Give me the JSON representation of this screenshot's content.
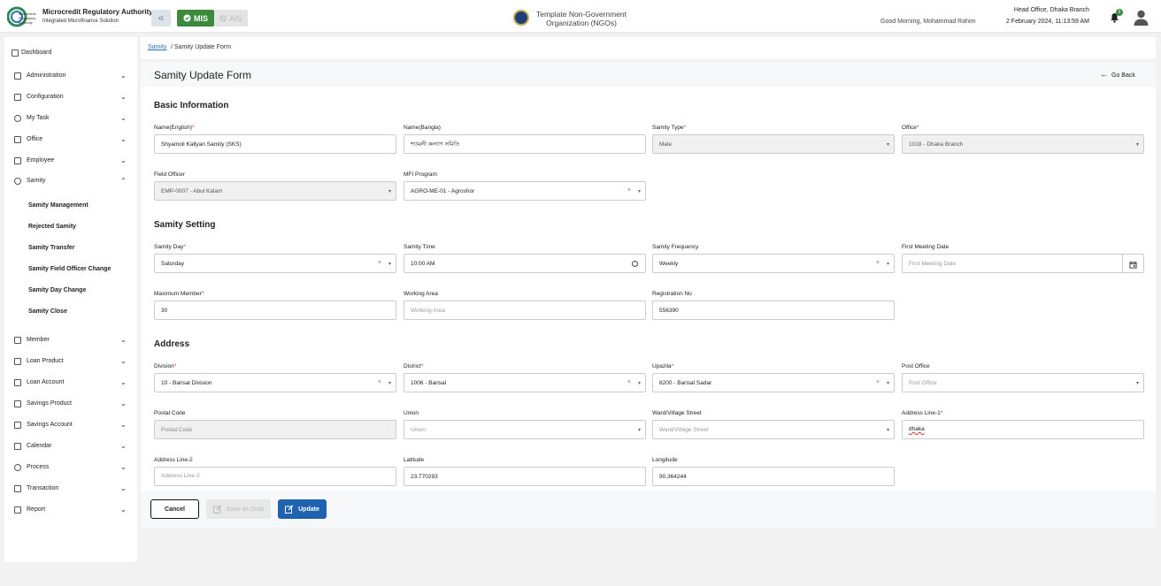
{
  "header": {
    "org_name": "Microcredit Regulatory Authority",
    "org_subtitle": "Integrated Microfinance Solution",
    "logo_text": "Microcredit Regulatory Authority",
    "mis_label": "MIS",
    "ais_label": "AIS",
    "ngo_title": "Template Non-Government Organization (NGOs)",
    "greeting": "Good Morning, Mohammad Rahim",
    "branch": "Head Office, Dhaka Branch",
    "datetime": "2 February 2024, 11:13:59 AM",
    "notification_count": "0",
    "accent_green": "#3b8a3e",
    "accent_blue": "#1f62b0"
  },
  "sidebar": {
    "dashboard": "Dashboard",
    "items": [
      {
        "label": "Administration",
        "icon": "admin-icon"
      },
      {
        "label": "Configuration",
        "icon": "sliders-icon"
      },
      {
        "label": "My Task",
        "icon": "task-icon"
      },
      {
        "label": "Office",
        "icon": "office-icon"
      },
      {
        "label": "Employee",
        "icon": "employee-icon"
      },
      {
        "label": "Samity",
        "icon": "samity-icon",
        "expanded": true
      }
    ],
    "samity_sub": [
      "Samity Management",
      "Rejected Samity",
      "Samity Transfer",
      "Samity Field Officer Change",
      "Samity Day Change",
      "Samity Close"
    ],
    "items_after": [
      {
        "label": "Member",
        "icon": "member-icon"
      },
      {
        "label": "Loan Product",
        "icon": "loan-product-icon"
      },
      {
        "label": "Loan Account",
        "icon": "loan-account-icon"
      },
      {
        "label": "Savings Product",
        "icon": "savings-product-icon"
      },
      {
        "label": "Savings Account",
        "icon": "savings-account-icon"
      },
      {
        "label": "Calendar",
        "icon": "calendar-icon"
      },
      {
        "label": "Process",
        "icon": "process-icon"
      },
      {
        "label": "Transaction",
        "icon": "transaction-icon"
      },
      {
        "label": "Report",
        "icon": "report-icon"
      }
    ]
  },
  "breadcrumb": {
    "link": "Samity",
    "current": "/ Samity Update Form"
  },
  "page": {
    "title": "Samity Update Form",
    "go_back": "Go Back"
  },
  "sections": {
    "basic": "Basic Information",
    "setting": "Samity Setting",
    "address": "Address"
  },
  "form": {
    "name_en": {
      "label": "Name(English)",
      "value": "Shyamoli Kallyan Samity (SKS)"
    },
    "name_bn": {
      "label": "Name(Bangla)",
      "value": "শ্যামলী কল্যাণ সমিতি"
    },
    "samity_type": {
      "label": "Samity Type",
      "value": "Male"
    },
    "office": {
      "label": "Office",
      "value": "1018 - Dhaka Branch"
    },
    "field_officer": {
      "label": "Field Officer",
      "value": "EMP-0007 - Abul Kalam"
    },
    "mfi_program": {
      "label": "MFI Program",
      "value": "AGRO-ME-01 - Agroshor"
    },
    "samity_day": {
      "label": "Samity Day",
      "value": "Saturday"
    },
    "samity_time": {
      "label": "Samity Time",
      "value": "10:00 AM"
    },
    "samity_frequency": {
      "label": "Samity Frequency",
      "value": "Weekly"
    },
    "first_meeting": {
      "label": "First Meeting Date",
      "placeholder": "First Meeting Date"
    },
    "max_member": {
      "label": "Maximum Member",
      "value": "30"
    },
    "working_area": {
      "label": "Working Area",
      "placeholder": "Working Area"
    },
    "registration_no": {
      "label": "Registration No",
      "value": "556390"
    },
    "division": {
      "label": "Division",
      "value": "10 - Barisal Division"
    },
    "district": {
      "label": "District",
      "value": "1006 - Barisal"
    },
    "upazila": {
      "label": "Upazila",
      "value": "8200 - Barisal Sadar"
    },
    "post_office": {
      "label": "Post Office",
      "placeholder": "Post Office"
    },
    "postal_code": {
      "label": "Postal Code",
      "placeholder": "Postal Code"
    },
    "union": {
      "label": "Union",
      "placeholder": "Union"
    },
    "ward": {
      "label": "Ward/Village Street",
      "placeholder": "Ward/Village Street"
    },
    "address1": {
      "label": "Address Line-1",
      "value": "dhaka"
    },
    "address2": {
      "label": "Address Line-2",
      "placeholder": "Address Line-2"
    },
    "latitude": {
      "label": "Latitude",
      "value": "23.770293"
    },
    "longitude": {
      "label": "Longitude",
      "value": "90.364244"
    }
  },
  "buttons": {
    "cancel": "Cancel",
    "draft": "Save as Draft",
    "update": "Update"
  }
}
